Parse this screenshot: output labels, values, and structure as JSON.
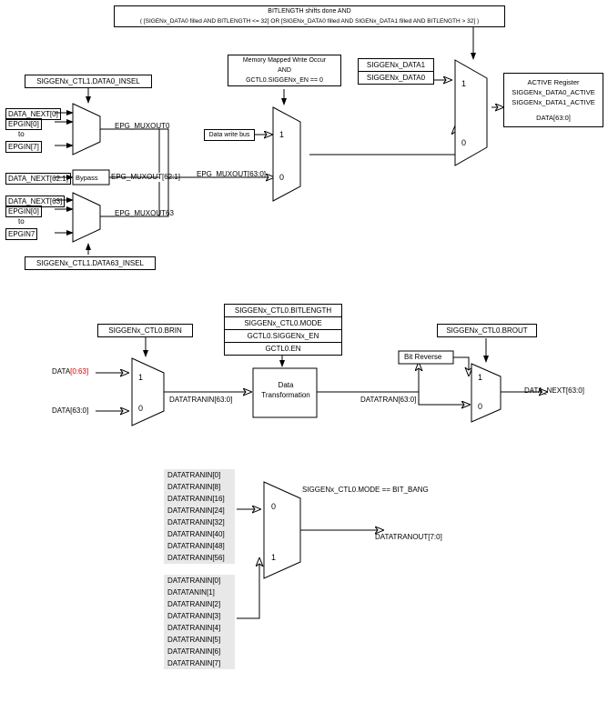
{
  "top": {
    "cond_line1": "BITLENGTH shifts done AND",
    "cond_line2": "( [SIGENx_DATA0 filled AND BITLENGTH <= 32] OR [SIGENx_DATA0 filled AND SIGENx_DATA1 filled AND BITLENGTH > 32] )",
    "mem_line1": "Memory Mapped Write Occur",
    "mem_line2": "AND",
    "mem_line3": "GCTL0.SIGGENx_EN == 0",
    "d1": "SIGGENx_DATA1",
    "d0": "SIGGENx_DATA0",
    "active_title": "ACTIVE Register",
    "active_r1": "SIGGENx_DATA0_ACTIVE",
    "active_r2": "SIGGENx_DATA1_ACTIVE",
    "active_r3": "DATA[63:0]",
    "data_write_bus": "Data write bus",
    "ctl1_data0": "SIGGENx_CTL1.DATA0_INSEL",
    "ctl1_data63": "SIGGENx_CTL1.DATA63_INSEL",
    "dn0": "DATA_NEXT[0]",
    "ep0": "EPGIN[0]",
    "to": "to",
    "ep7": "EPGIN[7]",
    "dn62": "DATA_NEXT[62:1]",
    "bypass": "Bypass",
    "dn63": "DATA_NEXT[63]",
    "ep7b": "EPGIN7",
    "emo0": "EPG_MUXOUT0",
    "emo62": "EPG_MUXOUT[62:1]",
    "emo63": "EPG_MUXOUT63",
    "emo_bus": "EPG_MUXOUT[63:0]"
  },
  "mid": {
    "ctl0brin": "SIGGENx_CTL0.BRIN",
    "data_rev": "DATA[0:63]",
    "data_fwd": "DATA[63:0]",
    "tranin": "DATATRANIN[63:0]",
    "datatransform": "Data\nTransformation",
    "params": {
      "p1": "SIGGENx_CTL0.BITLENGTH",
      "p2": "SIGGENx_CTL0.MODE",
      "p3": "GCTL0.SIGGENx_EN",
      "p4": "GCTL0.EN"
    },
    "ctl0brout": "SIGGENx_CTL0.BROUT",
    "bitrev": "Bit Reverse",
    "datatran": "DATATRAN[63:0]",
    "dn_out": "DATA_NEXT[63:0]"
  },
  "bot": {
    "col_a": [
      "DATATRANIN[0]",
      "DATATRANIN[8]",
      "DATATRANIN[16]",
      "DATATRANIN[24]",
      "DATATRANIN[32]",
      "DATATRANIN[40]",
      "DATATRANIN[48]",
      "DATATRANIN[56]"
    ],
    "col_b": [
      "DATATRANIN[0]",
      "DATATANIN[1]",
      "DATATRANIN[2]",
      "DATATRANIN[3]",
      "DATATRANIN[4]",
      "DATATRANIN[5]",
      "DATATRANIN[6]",
      "DATATRANIN[7]"
    ],
    "cond": "SIGGENx_CTL0.MODE == BIT_BANG",
    "out": "DATATRANOUT[7:0]"
  },
  "mux": {
    "one": "1",
    "zero": "0"
  }
}
